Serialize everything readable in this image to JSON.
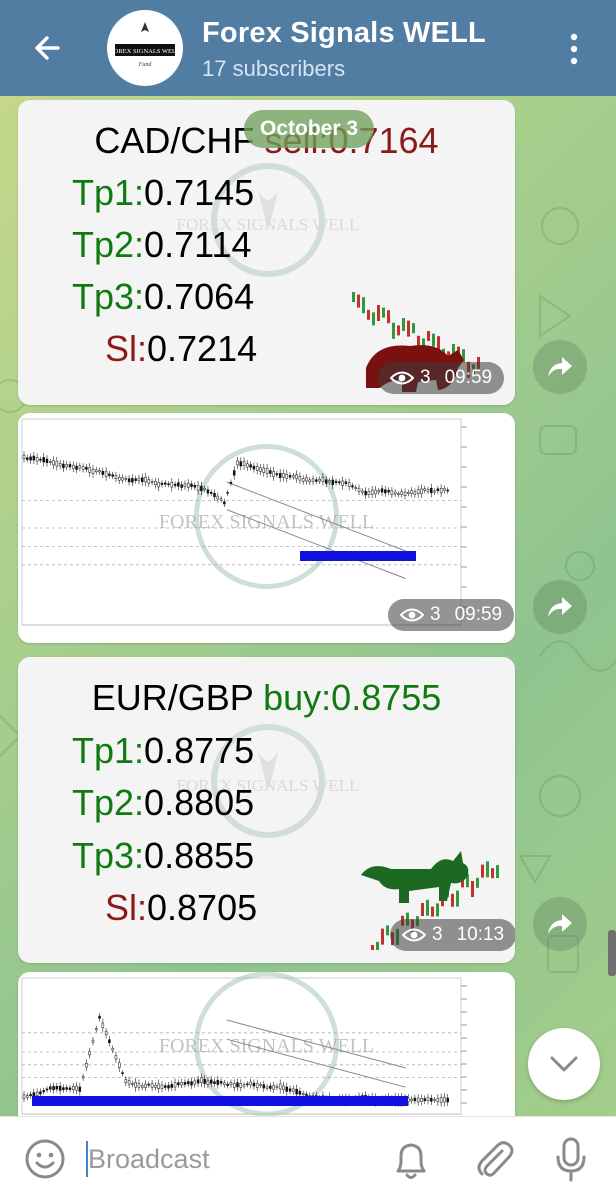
{
  "header": {
    "title": "Forex Signals WELL",
    "subtitle": "17 subscribers",
    "logo_text": "FOREX SIGNALS WELL",
    "logo_sub": "Fund"
  },
  "date_pill": "October 3",
  "messages": [
    {
      "type": "signal",
      "pair": "CAD/CHF",
      "action": "sell:0.7164",
      "direction": "sell",
      "levels": [
        {
          "label": "Tp1:",
          "value": "0.7145"
        },
        {
          "label": "Tp2:",
          "value": "0.7114"
        },
        {
          "label": "Tp3:",
          "value": "0.7064"
        },
        {
          "label": "Sl:",
          "value": "0.7214"
        }
      ],
      "views": "3",
      "time": "09:59",
      "watermark": "FOREX SIGNALS WELL"
    },
    {
      "type": "chart",
      "views": "3",
      "time": "09:59",
      "watermark": "FOREX SIGNALS WELL"
    },
    {
      "type": "signal",
      "pair": "EUR/GBP",
      "action": "buy:0.8755",
      "direction": "buy",
      "levels": [
        {
          "label": "Tp1:",
          "value": "0.8775"
        },
        {
          "label": "Tp2:",
          "value": "0.8805"
        },
        {
          "label": "Tp3:",
          "value": "0.8855"
        },
        {
          "label": "Sl:",
          "value": "0.8705"
        }
      ],
      "views": "3",
      "time": "10:13",
      "watermark": "FOREX SIGNALS WELL"
    },
    {
      "type": "chart",
      "watermark": "FOREX SIGNALS WELL"
    }
  ],
  "composer": {
    "placeholder": "Broadcast"
  },
  "colors": {
    "header": "#527da3",
    "tp_label": "#107a10",
    "sl_label": "#8b1a1a",
    "sell": "#8b1a1a",
    "buy": "#107a10",
    "zone": "#1010e0"
  }
}
